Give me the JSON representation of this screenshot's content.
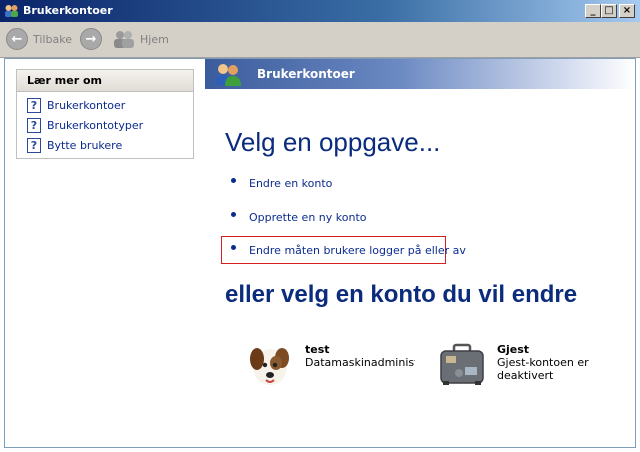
{
  "window": {
    "title": "Brukerkontoer"
  },
  "titlebar_buttons": {
    "minimize": "_",
    "maximize": "□",
    "close": "×"
  },
  "toolbar": {
    "back_label": "Tilbake",
    "home_label": "Hjem"
  },
  "left_pane": {
    "heading": "Lær mer om",
    "items": [
      {
        "label": "Brukerkontoer"
      },
      {
        "label": "Brukerkontotyper"
      },
      {
        "label": "Bytte brukere"
      }
    ]
  },
  "right_pane": {
    "banner_title": "Brukerkontoer",
    "task_heading": "Velg en oppgave...",
    "tasks": [
      {
        "label": "Endre en konto"
      },
      {
        "label": "Opprette en ny konto"
      },
      {
        "label": "Endre måten brukere logger på eller av"
      }
    ],
    "account_heading": "eller velg en konto du vil endre",
    "accounts": [
      {
        "name": "test",
        "description": "Datamaskinadministrator"
      },
      {
        "name": "Gjest",
        "description": "Gjest-kontoen er deaktivert"
      }
    ]
  },
  "colors": {
    "link": "#0b2c8f",
    "heading": "#0b2c7c",
    "highlight_border": "#d42020",
    "banner": "#3b5c9c"
  }
}
